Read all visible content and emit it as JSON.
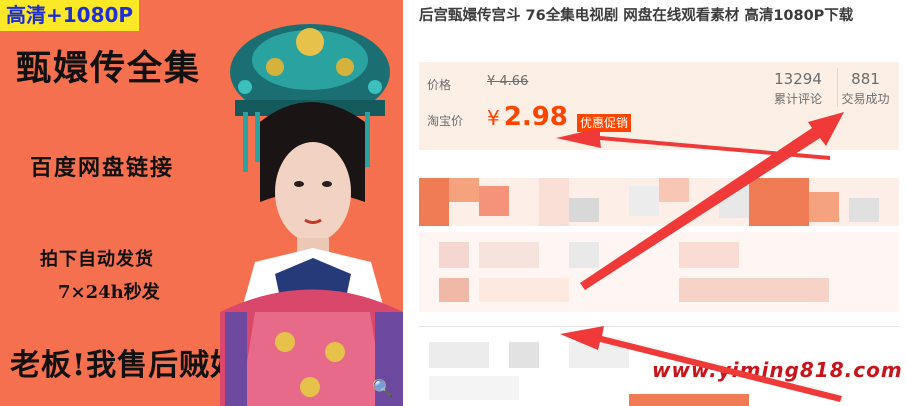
{
  "image": {
    "badge": "高清+1080P",
    "title": "甄嬛传全集",
    "line1": "百度网盘链接",
    "line2": "拍下自动发货",
    "line3": "7×24h秒发",
    "slogan": "老板!我售后贼好!",
    "zoom_icon": "magnifier-icon"
  },
  "product": {
    "title": "后宫甄嬛传宫斗 76全集电视剧 网盘在线观看素材 高清1080P下载"
  },
  "price": {
    "price_label": "价格",
    "original_price": "¥ 4.66",
    "taobao_label": "淘宝价",
    "currency": "¥",
    "current_price": "2.98",
    "promo_tag": "优惠促销"
  },
  "stats": {
    "reviews_count": "13294",
    "reviews_label": "累计评论",
    "sales_count": "881",
    "sales_label": "交易成功"
  },
  "watermark": "www.yiming818.com",
  "colors": {
    "accent": "#ff4400",
    "image_bg": "#f5704e",
    "price_box_bg": "#fcefe6",
    "arrow": "#f03a3a",
    "watermark": "#c8151b"
  }
}
